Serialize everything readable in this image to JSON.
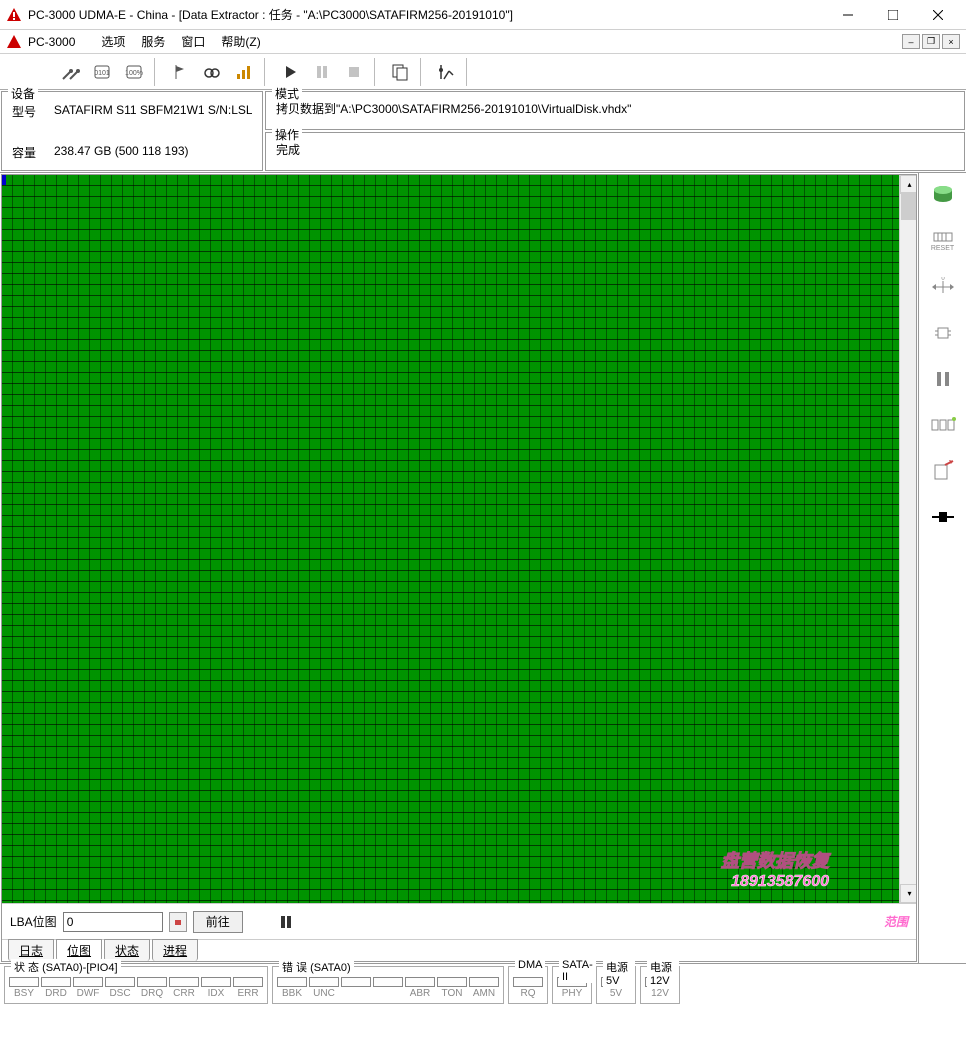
{
  "titlebar": {
    "title": "PC-3000 UDMA-E - China - [Data Extractor : 任务 - \"A:\\PC3000\\SATAFIRM256-20191010\"]"
  },
  "menubar": {
    "app_label": "PC-3000",
    "items": [
      "选项",
      "服务",
      "窗口",
      "帮助(Z)"
    ]
  },
  "info": {
    "device_legend": "设备",
    "model_label": "型号",
    "model_value": "SATAFIRM   S11 SBFM21W1 S/N:LSL",
    "capacity_label": "容量",
    "capacity_value": "238.47 GB (500 118 193)",
    "mode_legend": "模式",
    "mode_value": "拷贝数据到\"A:\\PC3000\\SATAFIRM256-20191010\\VirtualDisk.vhdx\"",
    "op_legend": "操作",
    "op_value": "完成"
  },
  "lba": {
    "label": "LBA位图",
    "value": "0",
    "go_label": "前往",
    "range_label": "范围"
  },
  "tabs": [
    "日志",
    "位图",
    "状态",
    "进程"
  ],
  "active_tab": 1,
  "watermark": {
    "line1": "盘营数据恢复",
    "line2": "18913587600"
  },
  "right_tools": {
    "reset_label": "RESET"
  },
  "status": {
    "sata0_legend": "状 态 (SATA0)-[PIO4]",
    "sata0_cells": [
      "BSY",
      "DRD",
      "DWF",
      "DSC",
      "DRQ",
      "CRR",
      "IDX",
      "ERR"
    ],
    "err_legend": "错 误 (SATA0)",
    "err_cells": [
      "BBK",
      "UNC",
      "",
      "",
      "ABR",
      "TON",
      "AMN"
    ],
    "dma_legend": "DMA",
    "dma_cells": [
      "RQ"
    ],
    "sata2_legend": "SATA-II",
    "sata2_cells": [
      "PHY"
    ],
    "p5_legend": "电源 5V",
    "p5_cells": [
      "5V"
    ],
    "p12_legend": "电源 12V",
    "p12_cells": [
      "12V"
    ]
  }
}
